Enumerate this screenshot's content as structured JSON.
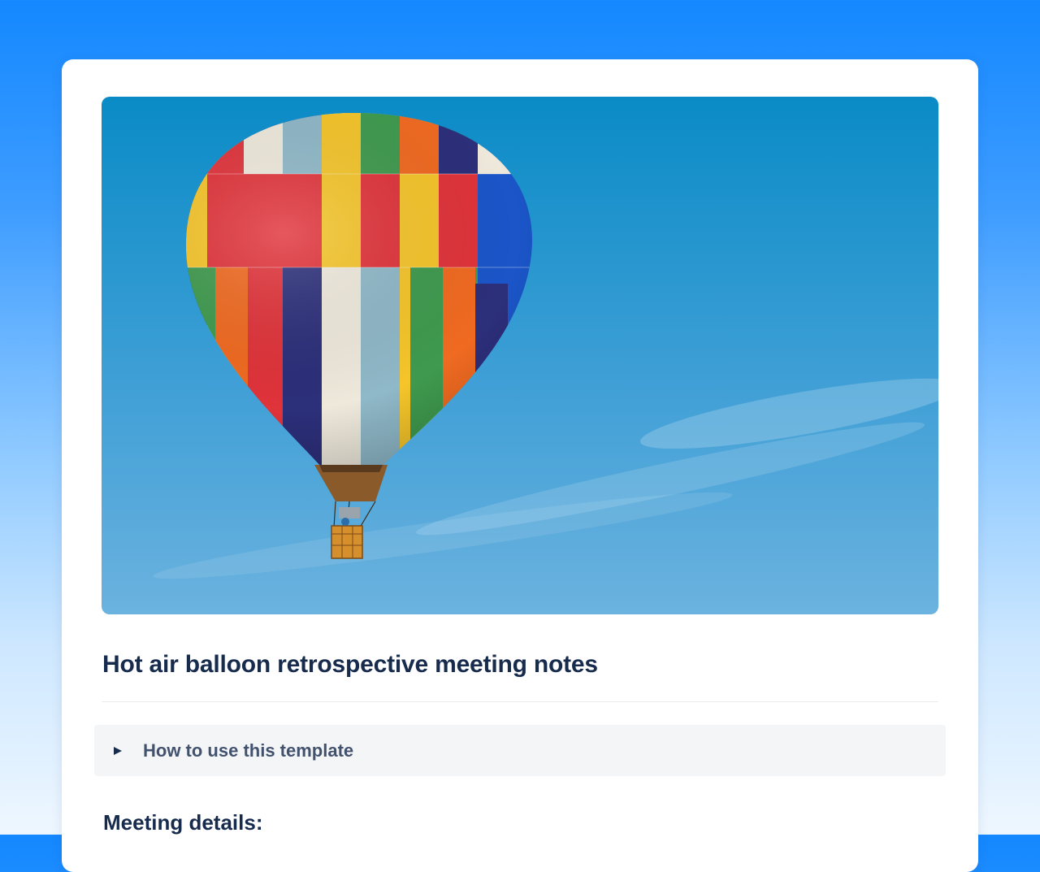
{
  "page": {
    "title": "Hot air balloon retrospective meeting notes"
  },
  "cover_image": {
    "subject": "hot-air-balloon",
    "colors": {
      "sky_top": "#0a85c0",
      "sky_bottom": "#6bb2df",
      "red": "#e0333a",
      "yellow": "#f5c52a",
      "green": "#3f9a4e",
      "blue": "#1b55c8",
      "navy": "#2c2f7a",
      "orange": "#f06a21",
      "cream": "#efe9dc",
      "teal": "#8fb8c8"
    }
  },
  "expand_section": {
    "label": "How to use this template",
    "icon": "triangle-right-icon"
  },
  "sections": {
    "meeting_details": "Meeting details:"
  },
  "colors": {
    "background_top": "#1488ff",
    "background_bottom": "#eef7ff",
    "text_primary": "#172b4d",
    "text_secondary": "#42526e",
    "expand_bg": "#f4f5f7"
  }
}
